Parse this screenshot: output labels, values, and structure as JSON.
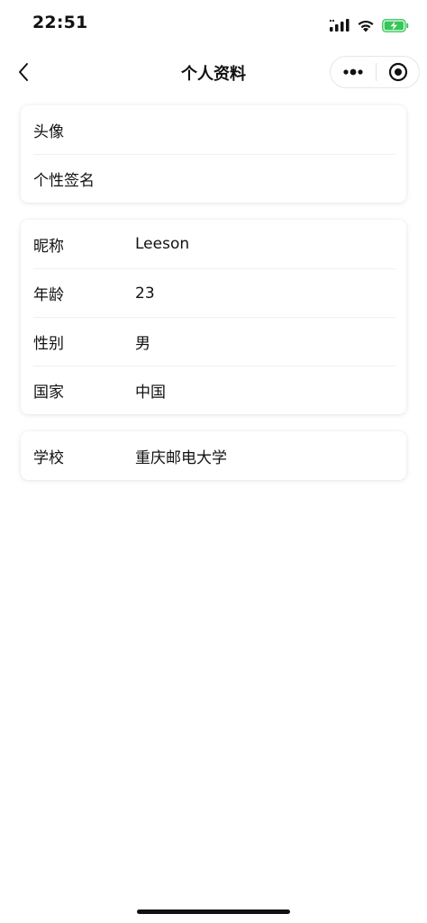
{
  "status_bar": {
    "time": "22:51",
    "icons": [
      "cellular-signal-icon",
      "wifi-icon",
      "battery-charging-icon"
    ],
    "battery_color": "#35c759"
  },
  "nav": {
    "title": "个人资料",
    "back_icon": "chevron-left-icon",
    "more_icon": "more-dots-icon",
    "close_icon": "target-circle-icon"
  },
  "sections": {
    "basic": [
      {
        "label": "头像",
        "value": ""
      },
      {
        "label": "个性签名",
        "value": ""
      }
    ],
    "profile": [
      {
        "label": "昵称",
        "value": "Leeson"
      },
      {
        "label": "年龄",
        "value": "23"
      },
      {
        "label": "性别",
        "value": "男"
      },
      {
        "label": "国家",
        "value": "中国"
      }
    ],
    "education": [
      {
        "label": "学校",
        "value": "重庆邮电大学"
      }
    ]
  }
}
